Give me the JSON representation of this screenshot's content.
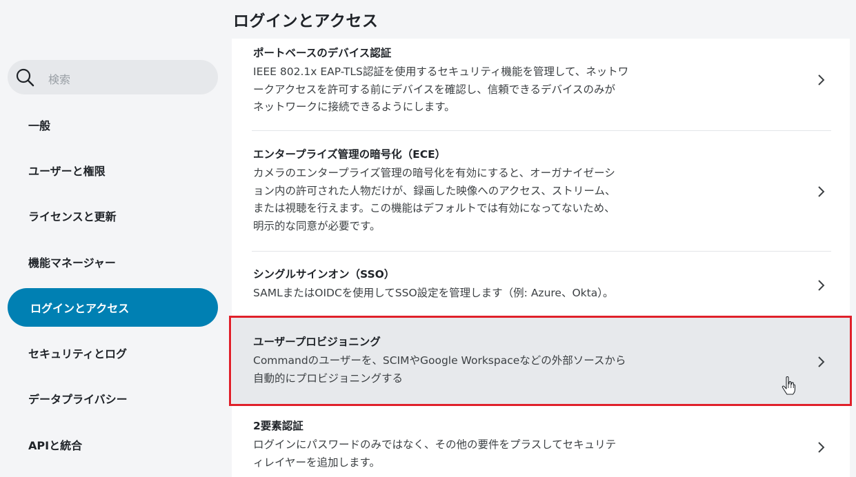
{
  "page_title": "ログインとアクセス",
  "search": {
    "placeholder": "検索",
    "icon": "search-icon"
  },
  "sidebar": {
    "items": [
      {
        "label": "一般",
        "active": false
      },
      {
        "label": "ユーザーと権限",
        "active": false
      },
      {
        "label": "ライセンスと更新",
        "active": false
      },
      {
        "label": "機能マネージャー",
        "active": false
      },
      {
        "label": "ログインとアクセス",
        "active": true
      },
      {
        "label": "セキュリティとログ",
        "active": false
      },
      {
        "label": "データプライバシー",
        "active": false
      },
      {
        "label": "APIと統合",
        "active": false
      }
    ]
  },
  "settings": [
    {
      "title": "ポートベースのデバイス認証",
      "desc": [
        "IEEE 802.1x EAP-TLS認証を使用するセキュリティ機能を管理して、ネットワ",
        "ークアクセスを許可する前にデバイスを確認し、信頼できるデバイスのみが",
        "ネットワークに接続できるようにします。"
      ]
    },
    {
      "title": "エンタープライズ管理の暗号化（ECE）",
      "desc": [
        "カメラのエンタープライズ管理の暗号化を有効にすると、オーガナイゼーシ",
        "ョン内の許可された人物だけが、録画した映像へのアクセス、ストリーム、",
        "または視聴を行えます。この機能はデフォルトでは有効になってないため、",
        "明示的な同意が必要です。"
      ]
    },
    {
      "title": "シングルサインオン（SSO）",
      "desc": [
        "SAMLまたはOIDCを使用してSSO設定を管理します（例: Azure、Okta）。"
      ]
    },
    {
      "title": "ユーザープロビジョニング",
      "desc": [
        "Commandのユーザーを、SCIMやGoogle Workspaceなどの外部ソースから",
        "自動的にプロビジョニングする"
      ]
    },
    {
      "title": "2要素認証",
      "desc": [
        "ログインにパスワードのみではなく、その他の要件をプラスしてセキュリテ",
        "ィレイヤーを追加します。"
      ]
    }
  ],
  "colors": {
    "accent": "#0080b3",
    "highlight": "#e0202a",
    "hover_bg": "#e7e9ec"
  }
}
